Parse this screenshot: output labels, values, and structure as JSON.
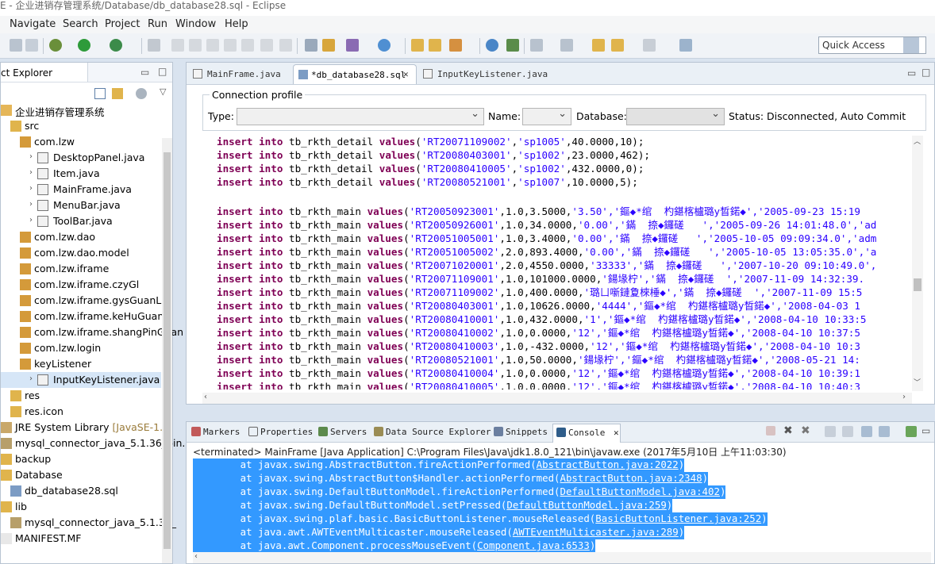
{
  "window": {
    "title": "E - 企业进销存管理系统/Database/db_database28.sql - Eclipse"
  },
  "menu": [
    "Navigate",
    "Search",
    "Project",
    "Run",
    "Window",
    "Help"
  ],
  "quick_access": "Quick Access",
  "explorer": {
    "tab": "ct Explorer",
    "rows": [
      {
        "label": "企业进销存管理系统",
        "indent": 0,
        "icon": "project"
      },
      {
        "label": "src",
        "indent": 1,
        "icon": "folder"
      },
      {
        "label": "com.lzw",
        "indent": 2,
        "icon": "package"
      },
      {
        "label": "DesktopPanel.java",
        "indent": 3,
        "icon": "java"
      },
      {
        "label": "Item.java",
        "indent": 3,
        "icon": "java"
      },
      {
        "label": "MainFrame.java",
        "indent": 3,
        "icon": "java"
      },
      {
        "label": "MenuBar.java",
        "indent": 3,
        "icon": "java"
      },
      {
        "label": "ToolBar.java",
        "indent": 3,
        "icon": "java"
      },
      {
        "label": "com.lzw.dao",
        "indent": 2,
        "icon": "package"
      },
      {
        "label": "com.lzw.dao.model",
        "indent": 2,
        "icon": "package"
      },
      {
        "label": "com.lzw.iframe",
        "indent": 2,
        "icon": "package"
      },
      {
        "label": "com.lzw.iframe.czyGl",
        "indent": 2,
        "icon": "package"
      },
      {
        "label": "com.lzw.iframe.gysGuanLi",
        "indent": 2,
        "icon": "package"
      },
      {
        "label": "com.lzw.iframe.keHuGuanLi",
        "indent": 2,
        "icon": "package"
      },
      {
        "label": "com.lzw.iframe.shangPinGuan",
        "indent": 2,
        "icon": "package"
      },
      {
        "label": "com.lzw.login",
        "indent": 2,
        "icon": "package"
      },
      {
        "label": "keyListener",
        "indent": 2,
        "icon": "package"
      },
      {
        "label": "InputKeyListener.java",
        "indent": 3,
        "icon": "java"
      },
      {
        "label": "res",
        "indent": 1,
        "icon": "folder"
      },
      {
        "label": "res.icon",
        "indent": 1,
        "icon": "folder"
      },
      {
        "label": "JRE System Library",
        "suffix": "[JavaSE-1.6]",
        "indent": 0,
        "icon": "library"
      },
      {
        "label": "mysql_connector_java_5.1.36_bin.",
        "indent": 0,
        "icon": "jar"
      },
      {
        "label": "backup",
        "indent": 0,
        "icon": "folder"
      },
      {
        "label": "Database",
        "indent": 0,
        "icon": "folder"
      },
      {
        "label": "db_database28.sql",
        "indent": 1,
        "icon": "sql"
      },
      {
        "label": "lib",
        "indent": 0,
        "icon": "folder"
      },
      {
        "label": "mysql_connector_java_5.1.36_",
        "indent": 1,
        "icon": "jar"
      },
      {
        "label": "MANIFEST.MF",
        "indent": 0,
        "icon": "file"
      }
    ]
  },
  "editor": {
    "tabs": [
      "MainFrame.java",
      "*db_database28.sql",
      "InputKeyListener.java"
    ],
    "connection": {
      "title": "Connection profile",
      "type_label": "Type:",
      "name_label": "Name:",
      "database_label": "Database:",
      "status": "Status: Disconnected, Auto Commit"
    },
    "lines": [
      {
        "kw": "insert into",
        "tbl": " tb_rkth_detail ",
        "v": "values",
        "rest": "(",
        "s1": "'RT20071109002'",
        "m": ",",
        "s2": "'sp1005'",
        "tail": ",40.0000,10);"
      },
      {
        "kw": "insert into",
        "tbl": " tb_rkth_detail ",
        "v": "values",
        "rest": "(",
        "s1": "'RT20080403001'",
        "m": ",",
        "s2": "'sp1002'",
        "tail": ",23.0000,462);"
      },
      {
        "kw": "insert into",
        "tbl": " tb_rkth_detail ",
        "v": "values",
        "rest": "(",
        "s1": "'RT20080410005'",
        "m": ",",
        "s2": "'sp1002'",
        "tail": ",432.0000,0);"
      },
      {
        "kw": "insert into",
        "tbl": " tb_rkth_detail ",
        "v": "values",
        "rest": "(",
        "s1": "'RT20080521001'",
        "m": ",",
        "s2": "'sp1007'",
        "tail": ",10.0000,5);"
      },
      {
        "kw": "",
        "tbl": "",
        "v": "",
        "rest": "",
        "s1": "",
        "m": "",
        "s2": "",
        "tail": ""
      },
      {
        "kw": "insert into",
        "tbl": " tb_rkth_main ",
        "v": "values",
        "rest": "(",
        "s1": "'RT20050923001'",
        "m": ",1.0,3.5000,",
        "s2": "'3.50','鏂◆*绾  杓鍖楁櫨璐у晳鍩◆','2005-09-23 15:19",
        "tail": ""
      },
      {
        "kw": "insert into",
        "tbl": " tb_rkth_main ",
        "v": "values",
        "rest": "(",
        "s1": "'RT20050926001'",
        "m": ",1.0,34.0000,",
        "s2": "'0.00','鏋  捺◆鑼磋   ','2005-09-26 14:01:48.0','ad",
        "tail": ""
      },
      {
        "kw": "insert into",
        "tbl": " tb_rkth_main ",
        "v": "values",
        "rest": "(",
        "s1": "'RT20051005001'",
        "m": ",1.0,3.4000,",
        "s2": "'0.00','鏋  捺◆鑼磋   ','2005-10-05 09:09:34.0','adm",
        "tail": ""
      },
      {
        "kw": "insert into",
        "tbl": " tb_rkth_main ",
        "v": "values",
        "rest": "(",
        "s1": "'RT20051005002'",
        "m": ",2.0,893.4000,",
        "s2": "'0.00','鏋  捺◆鑼磋   ','2005-10-05 13:05:35.0','a",
        "tail": ""
      },
      {
        "kw": "insert into",
        "tbl": " tb_rkth_main ",
        "v": "values",
        "rest": "(",
        "s1": "'RT20071020001'",
        "m": ",2.0,4550.0000,",
        "s2": "'33333','鏋  捺◆鑼磋   ','2007-10-20 09:10:49.0',",
        "tail": ""
      },
      {
        "kw": "insert into",
        "tbl": " tb_rkth_main ",
        "v": "values",
        "rest": "(",
        "s1": "'RT20071109001'",
        "m": ",1.0,101000.0000,",
        "s2": "'鍚堟柠','鏋  捺◆鑼磋  ','2007-11-09 14:32:39.",
        "tail": ""
      },
      {
        "kw": "insert into",
        "tbl": " tb_rkth_main ",
        "v": "values",
        "rest": "(",
        "s1": "'RT20071109002'",
        "m": ",1.0,400.0000,",
        "s2": "'璐ㄩ噺鏈夐棶棰◆','鏋  捺◆鑼磋  ','2007-11-09 15:5",
        "tail": ""
      },
      {
        "kw": "insert into",
        "tbl": " tb_rkth_main ",
        "v": "values",
        "rest": "(",
        "s1": "'RT20080403001'",
        "m": ",1.0,10626.0000,",
        "s2": "'4444','鏂◆*绾  杓鍖楁櫨璐у晳鍩◆','2008-04-03 1",
        "tail": ""
      },
      {
        "kw": "insert into",
        "tbl": " tb_rkth_main ",
        "v": "values",
        "rest": "(",
        "s1": "'RT20080410001'",
        "m": ",1.0,432.0000,",
        "s2": "'1','鏂◆*绾  杓鍖楁櫨璐у晳鍩◆','2008-04-10 10:33:5",
        "tail": ""
      },
      {
        "kw": "insert into",
        "tbl": " tb_rkth_main ",
        "v": "values",
        "rest": "(",
        "s1": "'RT20080410002'",
        "m": ",1.0,0.0000,",
        "s2": "'12','鏂◆*绾  杓鍖楁櫨璐у晳鍩◆','2008-04-10 10:37:5",
        "tail": ""
      },
      {
        "kw": "insert into",
        "tbl": " tb_rkth_main ",
        "v": "values",
        "rest": "(",
        "s1": "'RT20080410003'",
        "m": ",1.0,-432.0000,",
        "s2": "'12','鏂◆*绾  杓鍖楁櫨璐у晳鍩◆','2008-04-10 10:3",
        "tail": ""
      },
      {
        "kw": "insert into",
        "tbl": " tb_rkth_main ",
        "v": "values",
        "rest": "(",
        "s1": "'RT20080521001'",
        "m": ",1.0,50.0000,",
        "s2": "'鍚堟柠','鏂◆*绾  杓鍖楁櫨璐у晳鍩◆','2008-05-21 14:",
        "tail": ""
      },
      {
        "kw": "insert into",
        "tbl": " tb_rkth_main ",
        "v": "values",
        "rest": "(",
        "s1": "'RT20080410004'",
        "m": ",1.0,0.0000,",
        "s2": "'12','鏂◆*绾  杓鍖楁櫨璐у晳鍩◆','2008-04-10 10:39:1",
        "tail": ""
      },
      {
        "kw": "insert into",
        "tbl": " tb_rkth_main ",
        "v": "values",
        "rest": "(",
        "s1": "'RT20080410005'",
        "m": ",1.0,0.0000,",
        "s2": "'12','鏂◆*绾  杓鍖楁櫨璐у晳鍩◆','2008-04-10 10:40:3",
        "tail": ""
      }
    ]
  },
  "console": {
    "tabs": [
      "Markers",
      "Properties",
      "Servers",
      "Data Source Explorer",
      "Snippets",
      "Console"
    ],
    "terminated": "<terminated> MainFrame [Java Application] C:\\Program Files\\Java\\jdk1.8.0_121\\bin\\javaw.exe (2017年5月10日 上午11:03:30)",
    "stack": [
      {
        "pre": "        at javax.swing.AbstractButton.fireActionPerformed(",
        "link": "AbstractButton.java:2022",
        "post": ")"
      },
      {
        "pre": "        at javax.swing.AbstractButton$Handler.actionPerformed(",
        "link": "AbstractButton.java:2348",
        "post": ")"
      },
      {
        "pre": "        at javax.swing.DefaultButtonModel.fireActionPerformed(",
        "link": "DefaultButtonModel.java:402",
        "post": ")"
      },
      {
        "pre": "        at javax.swing.DefaultButtonModel.setPressed(",
        "link": "DefaultButtonModel.java:259",
        "post": ")"
      },
      {
        "pre": "        at javax.swing.plaf.basic.BasicButtonListener.mouseReleased(",
        "link": "BasicButtonListener.java:252",
        "post": ")"
      },
      {
        "pre": "        at java.awt.AWTEventMulticaster.mouseReleased(",
        "link": "AWTEventMulticaster.java:289",
        "post": ")"
      },
      {
        "pre": "        at java.awt.Component.processMouseEvent(",
        "link": "Component.java:6533",
        "post": ")"
      }
    ]
  },
  "colors": {
    "keyword": "#7f0055",
    "string": "#2a00ff",
    "selection": "#3399ff"
  }
}
